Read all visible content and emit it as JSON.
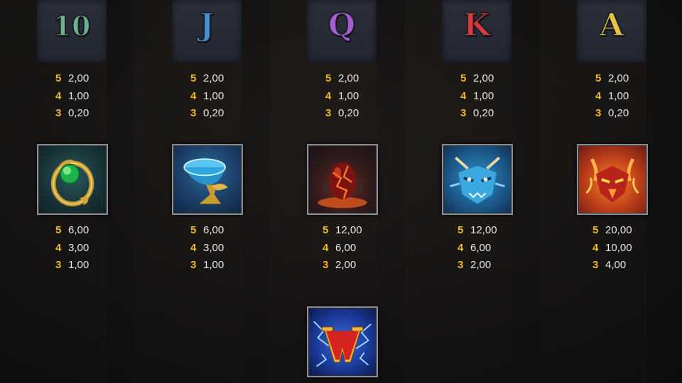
{
  "low_symbols": [
    {
      "glyph": "10",
      "icon": "ten-symbol-icon",
      "color": "#6fb08e",
      "pays": [
        {
          "count": "5",
          "value": "2,00"
        },
        {
          "count": "4",
          "value": "1,00"
        },
        {
          "count": "3",
          "value": "0,20"
        }
      ]
    },
    {
      "glyph": "J",
      "icon": "jack-symbol-icon",
      "color": "#4a8fd6",
      "pays": [
        {
          "count": "5",
          "value": "2,00"
        },
        {
          "count": "4",
          "value": "1,00"
        },
        {
          "count": "3",
          "value": "0,20"
        }
      ]
    },
    {
      "glyph": "Q",
      "icon": "queen-symbol-icon",
      "color": "#a45bd4",
      "pays": [
        {
          "count": "5",
          "value": "2,00"
        },
        {
          "count": "4",
          "value": "1,00"
        },
        {
          "count": "3",
          "value": "0,20"
        }
      ]
    },
    {
      "glyph": "K",
      "icon": "king-symbol-icon",
      "color": "#d83b3b",
      "pays": [
        {
          "count": "5",
          "value": "2,00"
        },
        {
          "count": "4",
          "value": "1,00"
        },
        {
          "count": "3",
          "value": "0,20"
        }
      ]
    },
    {
      "glyph": "A",
      "icon": "ace-symbol-icon",
      "color": "#e8c243",
      "pays": [
        {
          "count": "5",
          "value": "2,00"
        },
        {
          "count": "4",
          "value": "1,00"
        },
        {
          "count": "3",
          "value": "0,20"
        }
      ]
    }
  ],
  "high_symbols": [
    {
      "icon": "green-gem-ring-icon",
      "pays": [
        {
          "count": "5",
          "value": "6,00"
        },
        {
          "count": "4",
          "value": "3,00"
        },
        {
          "count": "3",
          "value": "1,00"
        }
      ]
    },
    {
      "icon": "golden-chalice-icon",
      "pays": [
        {
          "count": "5",
          "value": "6,00"
        },
        {
          "count": "4",
          "value": "3,00"
        },
        {
          "count": "3",
          "value": "1,00"
        }
      ]
    },
    {
      "icon": "dragon-egg-icon",
      "pays": [
        {
          "count": "5",
          "value": "12,00"
        },
        {
          "count": "4",
          "value": "6,00"
        },
        {
          "count": "3",
          "value": "2,00"
        }
      ]
    },
    {
      "icon": "blue-dragon-icon",
      "pays": [
        {
          "count": "5",
          "value": "12,00"
        },
        {
          "count": "4",
          "value": "6,00"
        },
        {
          "count": "3",
          "value": "2,00"
        }
      ]
    },
    {
      "icon": "fire-dragon-icon",
      "pays": [
        {
          "count": "5",
          "value": "20,00"
        },
        {
          "count": "4",
          "value": "10,00"
        },
        {
          "count": "3",
          "value": "4,00"
        }
      ]
    }
  ],
  "wild_symbol": {
    "glyph": "W",
    "icon": "wild-symbol-icon"
  }
}
